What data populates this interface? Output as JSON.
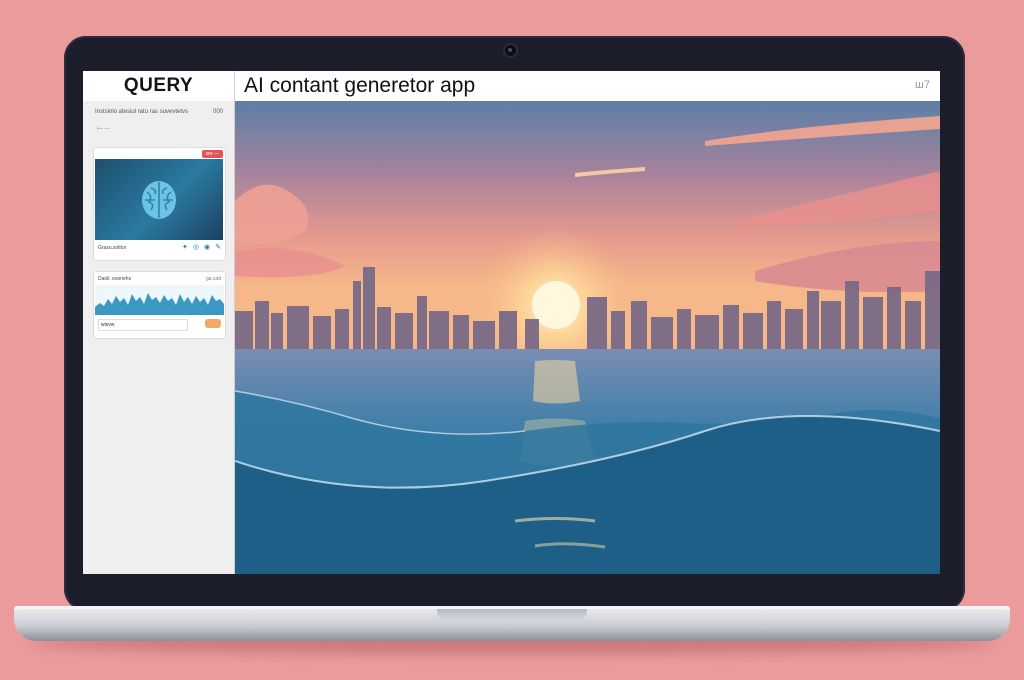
{
  "window": {
    "brand": "QUERY",
    "title": "AI contant generetor app",
    "controls": "ш7"
  },
  "sidebar": {
    "header_left": "Instsinlo atesiul ratu ras suvevtetvs",
    "header_right": "000",
    "sub": "i— —",
    "card": {
      "badge": "ser —",
      "caption": "Grasu.solitor",
      "icons": [
        "sparkle-icon",
        "share-icon",
        "comment-icon",
        "paint-icon"
      ]
    },
    "panel": {
      "title": "Daoil. esonehs",
      "value": "ga cad",
      "input_value": "wisvw"
    }
  },
  "colors": {
    "background": "#eb9b9c",
    "bezel": "#1c1d2a",
    "accent_badge": "#e0545a",
    "accent_button": "#f3a865"
  }
}
